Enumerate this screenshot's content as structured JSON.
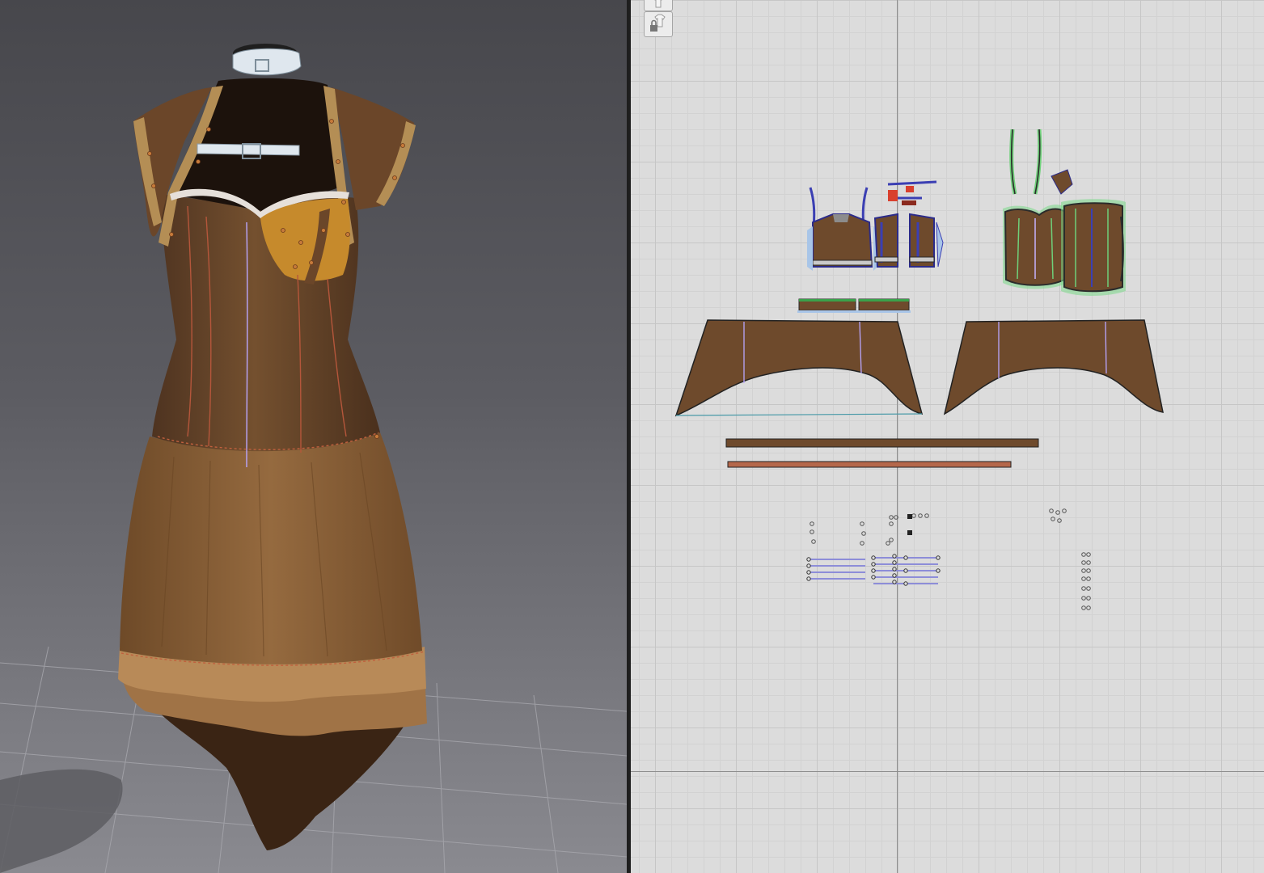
{
  "window": {
    "layout": "split-view"
  },
  "viewport_3d": {
    "background_top": "#47474c",
    "background_bottom": "#8a8a90"
  },
  "viewport_2d": {
    "background": "#dcdcdc"
  },
  "toolbar_2d": {
    "icons": [
      "shirt-icon",
      "lock-shirt-icon"
    ]
  },
  "colors": {
    "fabric_brown": "#6e4a2c",
    "fabric_dark": "#3a2414",
    "skirt_brown": "#8d6238",
    "ruffle_tan": "#b48454",
    "cup_orange": "#c68a2c",
    "strap_tan": "#b48e55",
    "belt_white": "#dfe7ee",
    "pattern_piece": "#6e4a2c",
    "seam_green": "#6fd07a",
    "seam_blue": "#3b3fb3"
  }
}
